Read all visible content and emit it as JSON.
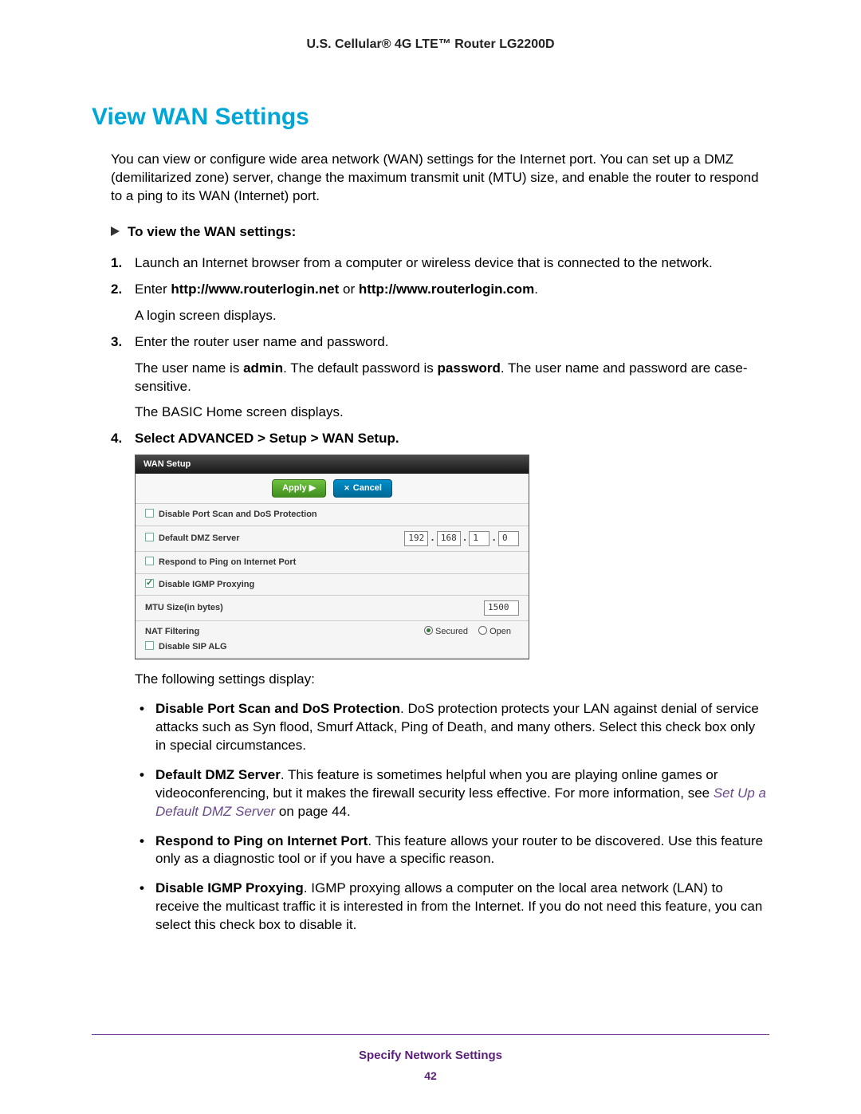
{
  "header": {
    "title": "U.S. Cellular® 4G LTE™ Router LG2200D"
  },
  "section": {
    "title": "View WAN Settings",
    "intro": "You can view or configure wide area network (WAN) settings for the Internet port. You can set up a DMZ (demilitarized zone) server, change the maximum transmit unit (MTU) size, and enable the router to respond to a ping to its WAN (Internet) port."
  },
  "procedure": {
    "heading": "To view the WAN settings:",
    "steps": [
      {
        "text": "Launch an Internet browser from a computer or wireless device that is connected to the network."
      },
      {
        "prefix": "Enter ",
        "bold": "http://www.routerlogin.net",
        "mid": " or ",
        "bold2": "http://www.routerlogin.com",
        "suffix": ".",
        "sub1": "A login screen displays."
      },
      {
        "text": "Enter the router user name and password.",
        "sub2_a": "The user name is ",
        "sub2_b": "admin",
        "sub2_c": ". The default password is ",
        "sub2_d": "password",
        "sub2_e": ". The user name and password are case-sensitive.",
        "sub3": "The BASIC Home screen displays."
      },
      {
        "bold_full": "Select ADVANCED > Setup > WAN Setup."
      }
    ]
  },
  "panel": {
    "title": "WAN Setup",
    "apply": "Apply ▶",
    "cancel": "Cancel",
    "rows": {
      "portscan": "Disable Port Scan and DoS Protection",
      "dmz": "Default DMZ Server",
      "ping": "Respond to Ping on Internet Port",
      "igmp": "Disable IGMP Proxying",
      "mtu": "MTU Size(in bytes)",
      "nat": "NAT Filtering",
      "sip": "Disable SIP ALG",
      "secured": "Secured",
      "open": "Open"
    },
    "ip": {
      "a": "192",
      "b": "168",
      "c": "1",
      "d": "0"
    },
    "mtu_val": "1500"
  },
  "after_panel": {
    "intro": "The following settings display:",
    "bullets": [
      {
        "bold": "Disable Port Scan and DoS Protection",
        "rest": ". DoS protection protects your LAN against denial of service attacks such as Syn flood, Smurf Attack, Ping of Death, and many others. Select this check box only in special circumstances."
      },
      {
        "bold": "Default DMZ Server",
        "rest_a": ". This feature is sometimes helpful when you are playing online games or videoconferencing, but it makes the firewall security less effective. For more information, see ",
        "link": "Set Up a Default DMZ Server",
        "rest_b": " on page 44."
      },
      {
        "bold": "Respond to Ping on Internet Port",
        "rest": ". This feature allows your router to be discovered. Use this feature only as a diagnostic tool or if you have a specific reason."
      },
      {
        "bold": "Disable IGMP Proxying",
        "rest": ". IGMP proxying allows a computer on the local area network (LAN) to receive the multicast traffic it is interested in from the Internet. If you do not need this feature, you can select this check box to disable it."
      }
    ]
  },
  "footer": {
    "title": "Specify Network Settings",
    "page": "42"
  }
}
